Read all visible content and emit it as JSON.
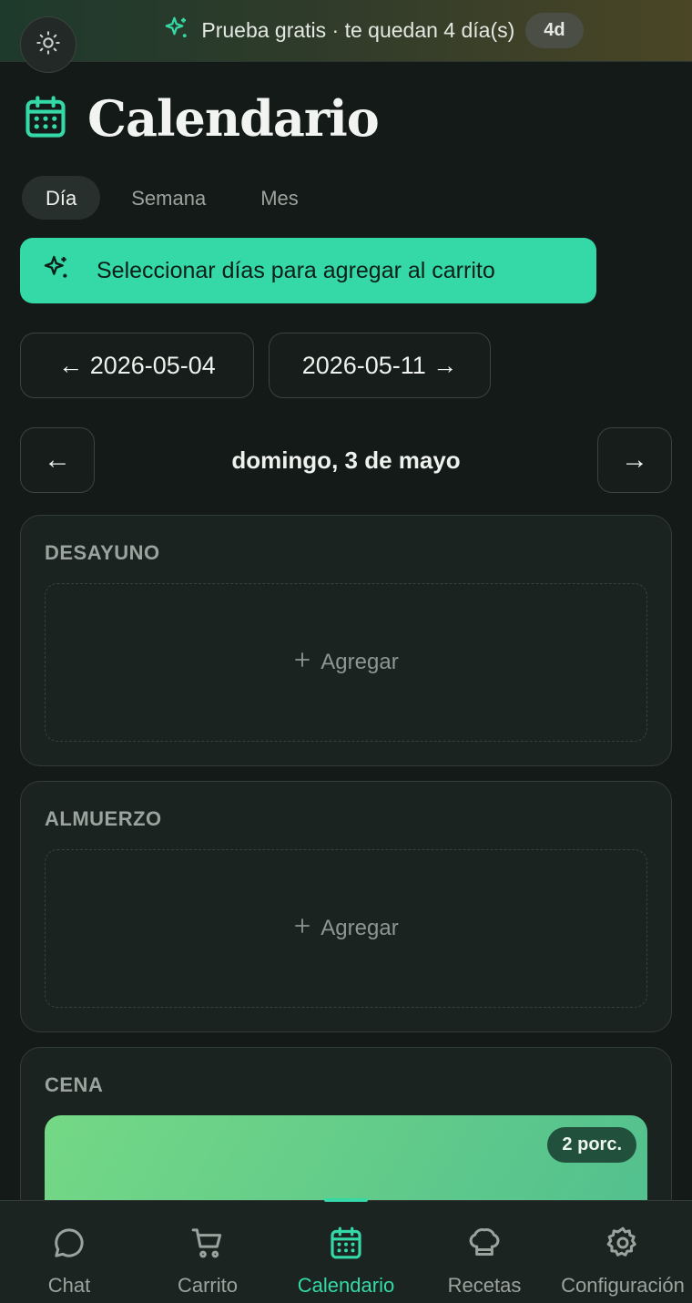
{
  "banner": {
    "text": "Prueba gratis · te quedan 4 día(s)",
    "badge": "4d"
  },
  "header": {
    "title": "Calendario"
  },
  "tabs": [
    {
      "label": "Día",
      "active": true
    },
    {
      "label": "Semana",
      "active": false
    },
    {
      "label": "Mes",
      "active": false
    }
  ],
  "select_days_button": "Seleccionar días para agregar al carrito",
  "week_nav": {
    "prev_label": "← 2026-05-04",
    "next_label": "2026-05-11 →"
  },
  "day_nav": {
    "prev": "←",
    "date": "domingo, 3 de mayo",
    "next": "→"
  },
  "meals": [
    {
      "title": "DESAYUNO",
      "add_label": "Agregar"
    },
    {
      "title": "ALMUERZO",
      "add_label": "Agregar"
    },
    {
      "title": "CENA",
      "portion_badge": "2 porc."
    }
  ],
  "bottom_nav": [
    {
      "label": "Chat",
      "icon": "chat-bubble-icon"
    },
    {
      "label": "Carrito",
      "icon": "cart-icon"
    },
    {
      "label": "Calendario",
      "icon": "calendar-icon",
      "active": true
    },
    {
      "label": "Recetas",
      "icon": "chef-hat-icon"
    },
    {
      "label": "Configuración",
      "icon": "gear-icon"
    }
  ],
  "colors": {
    "accent": "#34d9a7",
    "background": "#131a17",
    "card": "#1b2320"
  }
}
